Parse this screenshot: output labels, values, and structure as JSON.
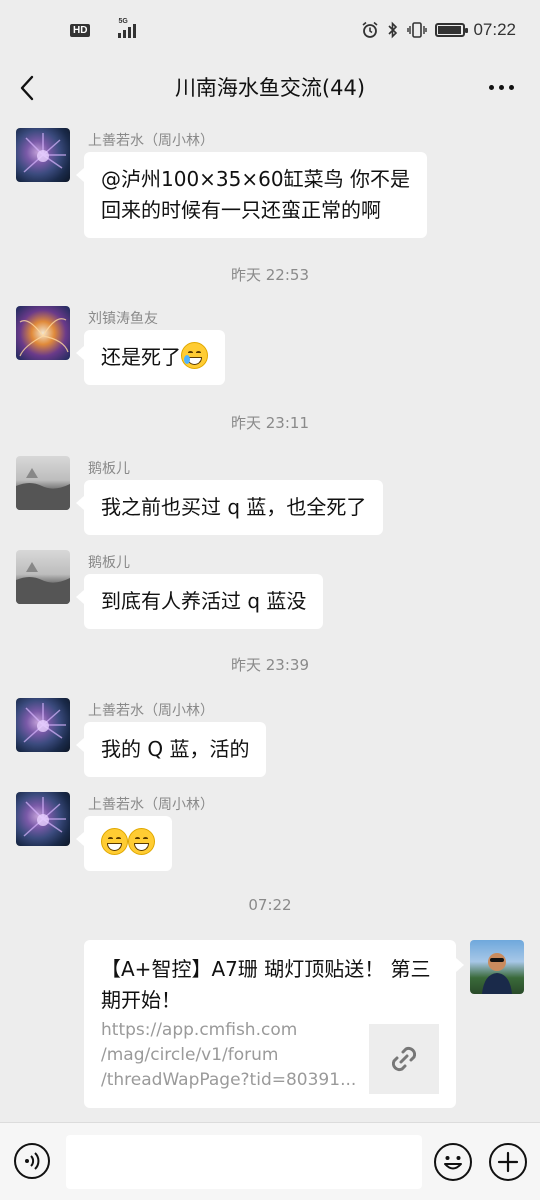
{
  "status_bar": {
    "hd_label": "HD",
    "network_label": "5G",
    "time": "07:22",
    "battery_level": 0.85,
    "icons": [
      "alarm-icon",
      "bluetooth-icon",
      "vibrate-icon",
      "battery-icon"
    ]
  },
  "header": {
    "title": "川南海水鱼交流(44)",
    "back_icon": "chevron-left-icon",
    "more_icon": "more-dots-icon"
  },
  "messages": [
    {
      "sender": "上善若水（周小林）",
      "text_lines": [
        "@泸州100×35×60缸菜鸟 你不是",
        "回来的时候有一只还蛮正常的啊"
      ]
    },
    {
      "time": "昨天 22:53"
    },
    {
      "sender": "刘镇涛鱼友",
      "text": "还是死了",
      "emoji": "crying-laughing-emoji"
    },
    {
      "time": "昨天 23:11"
    },
    {
      "sender": "鹅板儿",
      "text": "我之前也买过 q 蓝，也全死了"
    },
    {
      "sender": "鹅板儿",
      "text": "到底有人养活过 q 蓝没"
    },
    {
      "time": "昨天 23:39"
    },
    {
      "sender": "上善若水（周小林）",
      "text": "我的 Q 蓝，活的"
    },
    {
      "sender": "上善若水（周小林）",
      "emoji": "grinning-emoji",
      "emoji_count": 2
    },
    {
      "time": "07:22"
    },
    {
      "outgoing": true,
      "link_title": "【A+智控】A7珊 瑚灯顶贴送！ 第三期开始！",
      "link_url_lines": [
        "https://app.cmfish.com",
        "/mag/circle/v1/forum",
        "/threadWapPage?tid=80391..."
      ],
      "thumb_icon": "link-icon"
    }
  ],
  "input_bar": {
    "voice_icon": "voice-icon",
    "input_value": "",
    "emoji_icon": "emoji-icon",
    "plus_icon": "plus-icon"
  },
  "colors": {
    "background": "#ededed",
    "bubble": "#ffffff",
    "timestamp": "#8a8a8a"
  }
}
